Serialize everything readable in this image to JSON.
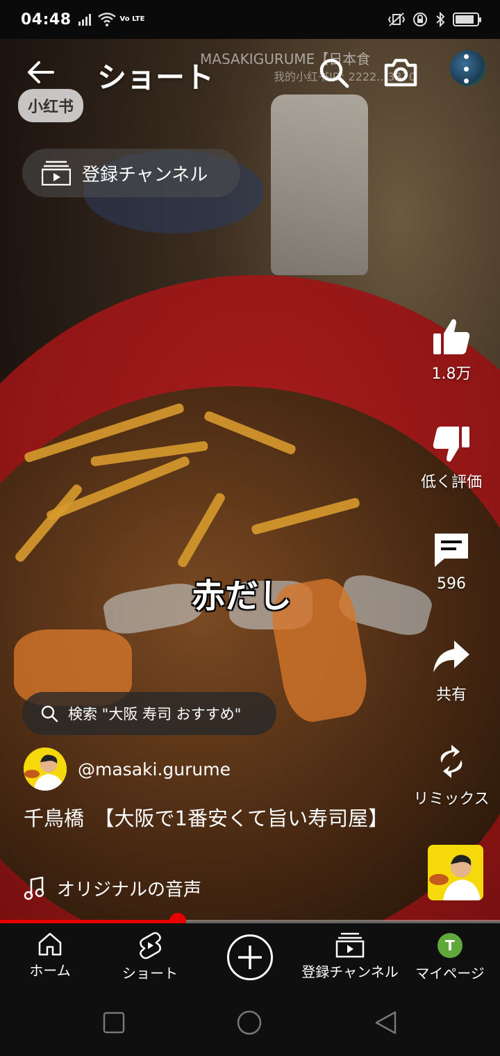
{
  "status_bar": {
    "time": "04:48",
    "network": "Vo LTE",
    "battery_level": 0.75
  },
  "video": {
    "watermark_app": "小红书",
    "watermark_line1": "MASAKIGURUME【日本食",
    "watermark_line2": "我的小红书ID: 2222…3370",
    "caption": "赤だし"
  },
  "header": {
    "title": "ショート",
    "back_icon": "arrow-left-icon",
    "search_icon": "search-icon",
    "camera_icon": "camera-icon"
  },
  "subscriptions_chip": {
    "label": "登録チャンネル"
  },
  "actions": {
    "like_count": "1.8万",
    "dislike_label": "低く評価",
    "comment_count": "596",
    "share_label": "共有",
    "remix_label": "リミックス"
  },
  "search_suggestion": {
    "text": "検索 \"大阪 寿司 おすすめ\""
  },
  "channel": {
    "handle": "@masaki.gurume"
  },
  "video_title": "千鳥橋　【大阪で1番安くて旨い寿司屋】",
  "music": {
    "label": "オリジナルの音声"
  },
  "progress": {
    "played_fraction": 0.355
  },
  "bottom_nav": {
    "home": "ホーム",
    "shorts": "ショート",
    "subscriptions": "登録チャンネル",
    "mypage": "マイページ",
    "mypage_initial": "T"
  },
  "colors": {
    "accent_red": "#e60000",
    "nav_background": "#0f0f0f"
  }
}
